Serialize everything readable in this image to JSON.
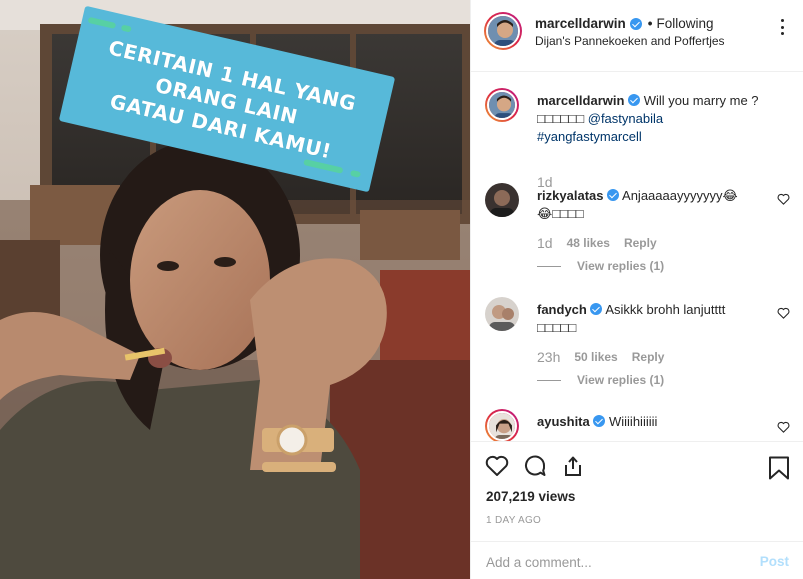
{
  "sticker": {
    "text_line1": "CERITAIN 1 HAL YANG ORANG LAIN",
    "text_line2": "GATAU DARI KAMU!"
  },
  "header": {
    "username": "marcelldarwin",
    "separator": "•",
    "follow_status": "Following",
    "location": "Dijan's Pannekoeken and Poffertjes"
  },
  "caption": {
    "username": "marcelldarwin",
    "text": "Will you marry me ?",
    "line2_emoji": "□□□□□□",
    "mention": "@fastynabila",
    "hashtag": "#yangfastymarcell",
    "time": "1d"
  },
  "comments": [
    {
      "username": "rizkyalatas",
      "text_line1": "Anjaaaaayyyyyyy😂",
      "text_line2": "😂□□□□",
      "time": "1d",
      "likes": "48 likes",
      "reply_label": "Reply",
      "view_replies": "View replies (1)"
    },
    {
      "username": "fandych",
      "text_line1": "Asikkk brohh lanjutttt",
      "text_line2": "□□□□□",
      "time": "23h",
      "likes": "50 likes",
      "reply_label": "Reply",
      "view_replies": "View replies (1)"
    },
    {
      "username": "ayushita",
      "text_line1": "Wiiiihiiiiii"
    }
  ],
  "stats": {
    "views": "207,219 views",
    "posted": "1 DAY AGO"
  },
  "composer": {
    "placeholder": "Add a comment...",
    "post_label": "Post"
  },
  "colors": {
    "verified": "#3897f0",
    "sticker_bg": "#57b9d9",
    "sticker_accent": "#57d0a4",
    "post_disabled": "#b2dffc"
  }
}
